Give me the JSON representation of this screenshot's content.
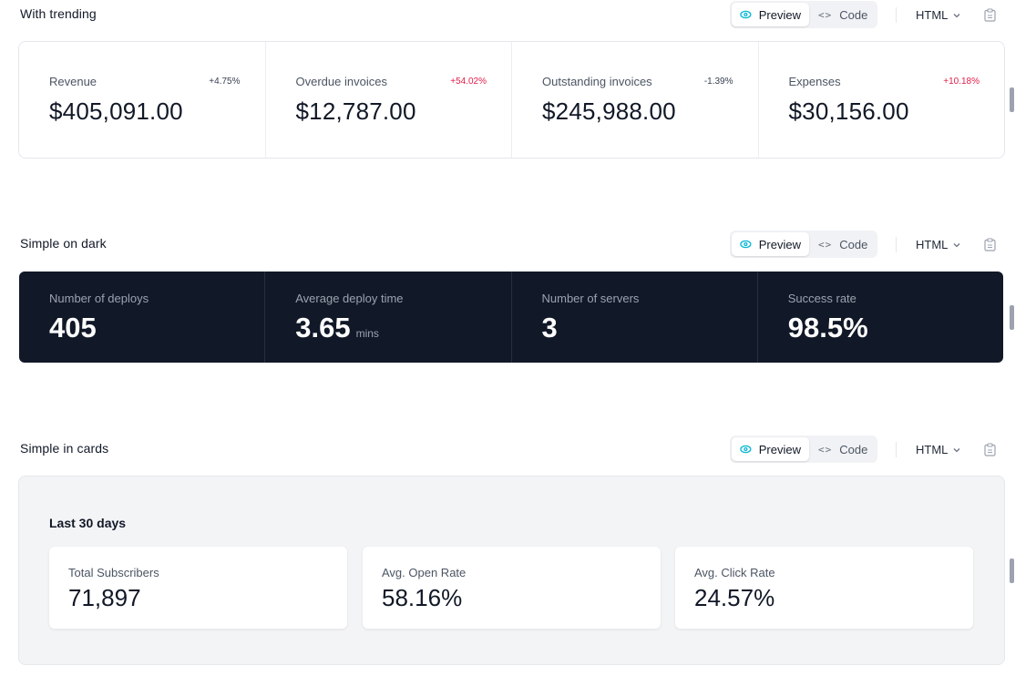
{
  "controls": {
    "preview_label": "Preview",
    "code_label": "Code",
    "language": "HTML"
  },
  "trending": {
    "title": "With trending",
    "stats": [
      {
        "label": "Revenue",
        "value": "$405,091.00",
        "change": "+4.75%",
        "change_color": "#374151"
      },
      {
        "label": "Overdue invoices",
        "value": "$12,787.00",
        "change": "+54.02%",
        "change_color": "#e11d48"
      },
      {
        "label": "Outstanding invoices",
        "value": "$245,988.00",
        "change": "-1.39%",
        "change_color": "#374151"
      },
      {
        "label": "Expenses",
        "value": "$30,156.00",
        "change": "+10.18%",
        "change_color": "#e11d48"
      }
    ]
  },
  "dark": {
    "title": "Simple on dark",
    "stats": [
      {
        "label": "Number of deploys",
        "value": "405",
        "unit": ""
      },
      {
        "label": "Average deploy time",
        "value": "3.65",
        "unit": "mins"
      },
      {
        "label": "Number of servers",
        "value": "3",
        "unit": ""
      },
      {
        "label": "Success rate",
        "value": "98.5%",
        "unit": ""
      }
    ]
  },
  "cards": {
    "title": "Simple in cards",
    "heading": "Last 30 days",
    "stats": [
      {
        "label": "Total Subscribers",
        "value": "71,897"
      },
      {
        "label": "Avg. Open Rate",
        "value": "58.16%"
      },
      {
        "label": "Avg. Click Rate",
        "value": "24.57%"
      }
    ]
  }
}
